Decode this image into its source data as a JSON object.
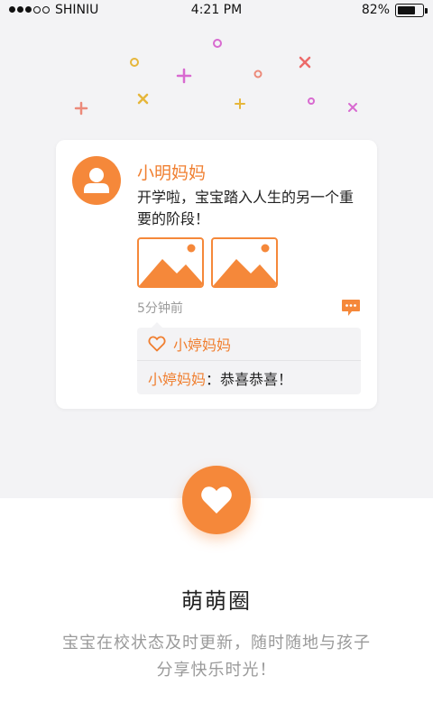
{
  "status_bar": {
    "carrier": "SHINIU",
    "time": "4:21 PM",
    "battery_percent_label": "82%",
    "battery_level": 0.82,
    "signal_filled": 3,
    "signal_total": 5
  },
  "post": {
    "author": "小明妈妈",
    "text": "开学啦，宝宝踏入人生的另一个重要的阶段！",
    "time_ago": "5分钟前",
    "likes": {
      "liker": "小婷妈妈"
    },
    "reply": {
      "author": "小婷妈妈",
      "separator": "：",
      "text": "恭喜恭喜！"
    }
  },
  "feature": {
    "icon": "heart-icon",
    "title": "萌萌圈",
    "description": "宝宝在校状态及时更新，随时随地与孩子分享快乐时光！"
  },
  "colors": {
    "accent": "#f5883a",
    "accent_text": "#f07f30",
    "background_top": "#f3f3f5"
  }
}
